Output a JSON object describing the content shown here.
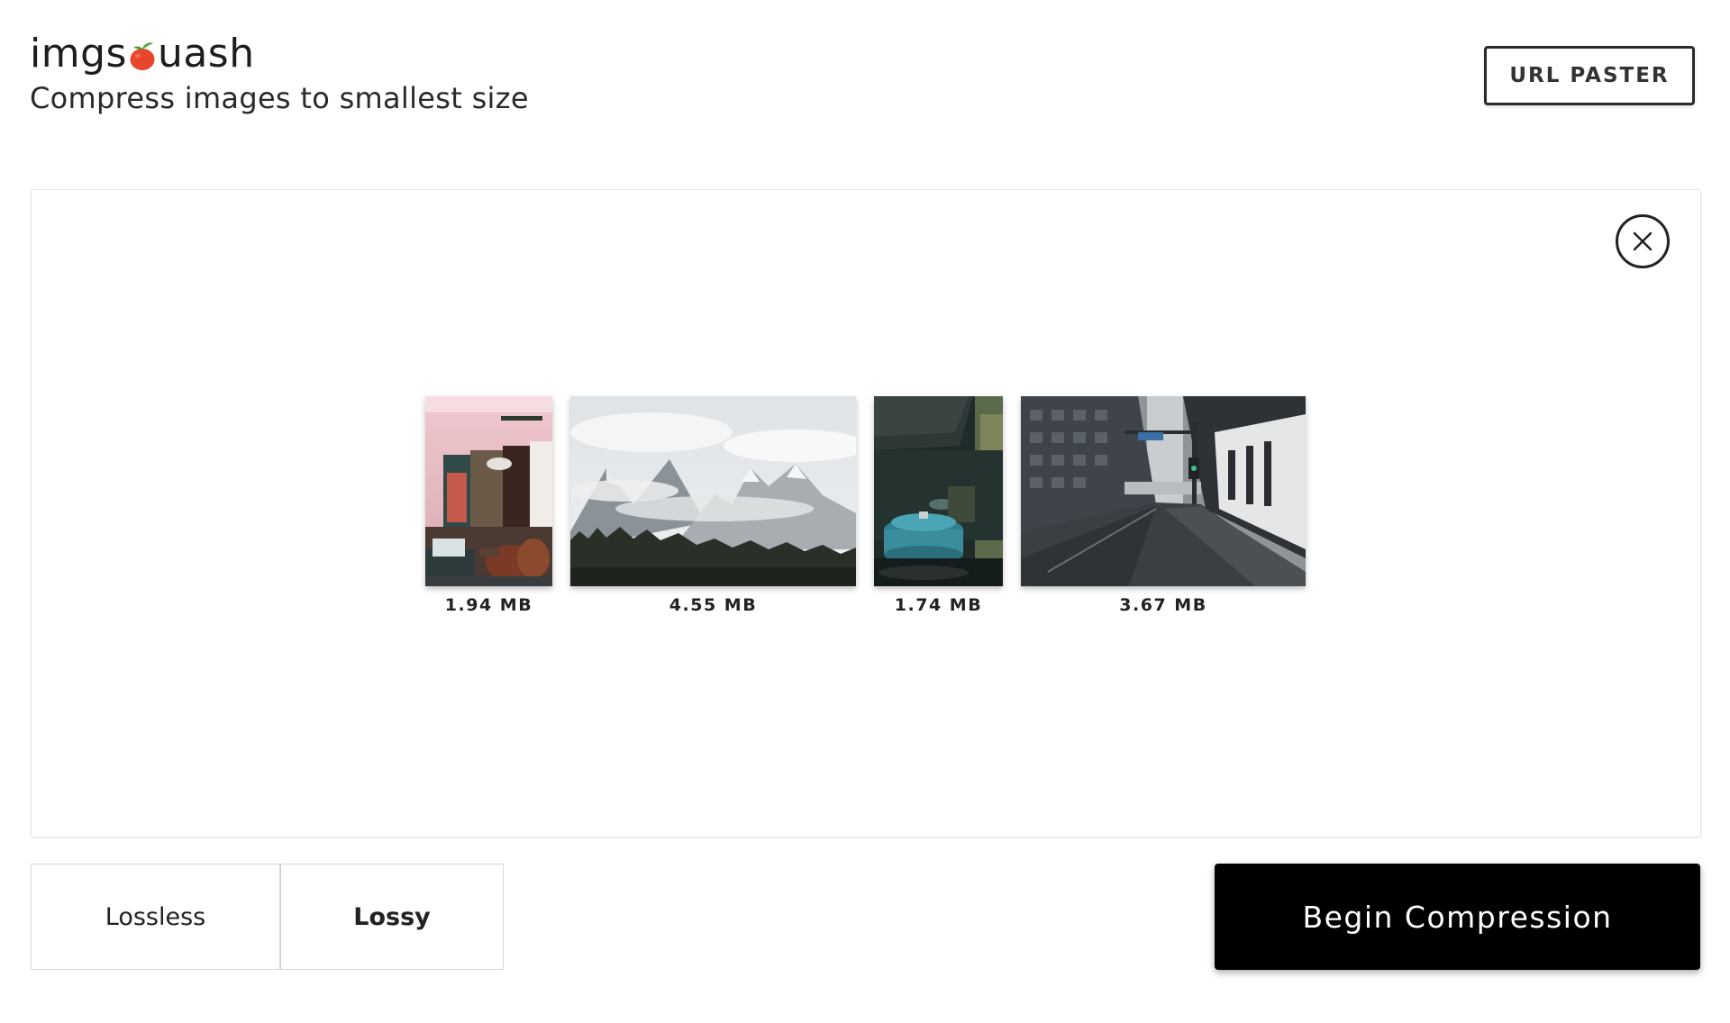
{
  "header": {
    "logo_left": "imgs",
    "logo_right": "uash",
    "logo_icon": "tomato-icon",
    "tagline": "Compress images to smallest size",
    "url_paster_label": "URL PASTER"
  },
  "dropzone": {
    "close_icon": "close-icon",
    "images": [
      {
        "size": "1.94 MB",
        "subject": "interior room"
      },
      {
        "size": "4.55 MB",
        "subject": "misty mountains"
      },
      {
        "size": "1.74 MB",
        "subject": "kitchen pot"
      },
      {
        "size": "3.67 MB",
        "subject": "city street"
      }
    ]
  },
  "controls": {
    "modes": [
      {
        "label": "Lossless",
        "selected": false
      },
      {
        "label": "Lossy",
        "selected": true
      }
    ],
    "begin_label": "Begin Compression"
  },
  "colors": {
    "accent": "#e8452c",
    "leaf": "#4caf38",
    "primary_button": "#000000"
  }
}
